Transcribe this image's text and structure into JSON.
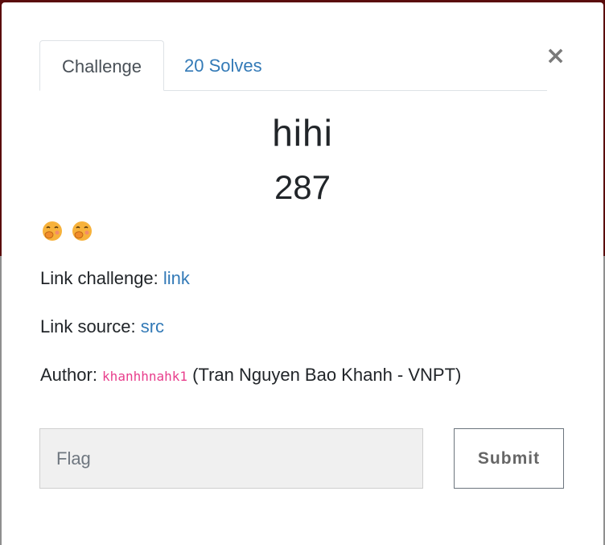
{
  "tabs": {
    "challenge_label": "Challenge",
    "solves_label": "20 Solves"
  },
  "close": {
    "symbol": "×"
  },
  "challenge": {
    "name": "hihi",
    "points": "287",
    "emojis": [
      "face-with-hand-over-mouth-icon",
      "face-with-hand-over-mouth-icon"
    ],
    "link_challenge_label": "Link challenge: ",
    "link_challenge_text": "link",
    "link_source_label": "Link source: ",
    "link_source_text": "src",
    "author_label": "Author: ",
    "author_handle": "khanhhnahk1",
    "author_details": " (Tran Nguyen Bao Khanh - VNPT)"
  },
  "form": {
    "flag_placeholder": "Flag",
    "submit_label": "Submit"
  },
  "colors": {
    "link": "#337ab7",
    "code": "#e83e8c",
    "backdrop_top": "#5a0c0c",
    "backdrop_bottom": "#8f8f8f"
  }
}
